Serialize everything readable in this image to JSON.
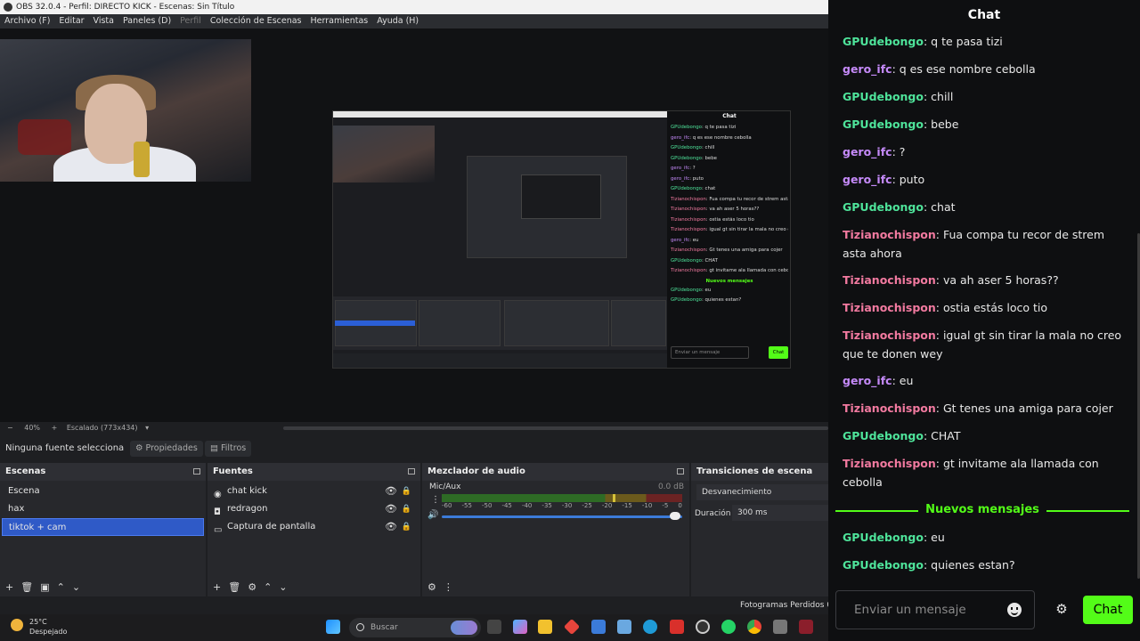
{
  "window": {
    "title": "OBS 32.0.4 - Perfil: DIRECTO KICK - Escenas: Sin Título",
    "menu": [
      "Archivo (F)",
      "Editar",
      "Vista",
      "Paneles (D)",
      "Perfil",
      "Colección de Escenas",
      "Herramientas",
      "Ayuda (H)"
    ]
  },
  "preview": {
    "zoom": "40%",
    "zoom_minus": "−",
    "zoom_plus": "+",
    "scale_label": "Escalado (773x434)"
  },
  "props_bar": {
    "no_source": "Ninguna fuente selecciona",
    "properties": "Propiedades",
    "filters": "Filtros"
  },
  "scenes": {
    "title": "Escenas",
    "items": [
      "Escena",
      "hax",
      "tiktok + cam"
    ],
    "selected": "tiktok + cam"
  },
  "sources": {
    "title": "Fuentes",
    "items": [
      {
        "label": "chat kick",
        "icon": "browser-icon"
      },
      {
        "label": "redragon",
        "icon": "camera-icon"
      },
      {
        "label": "Captura de pantalla",
        "icon": "monitor-icon"
      }
    ]
  },
  "mixer": {
    "title": "Mezclador de audio",
    "channel": "Mic/Aux",
    "db": "0.0 dB",
    "ticks": [
      "-60",
      "-55",
      "-50",
      "-45",
      "-40",
      "-35",
      "-30",
      "-25",
      "-20",
      "-15",
      "-10",
      "-5",
      "0"
    ],
    "peak_level": 0.71,
    "volume_level": 1.0
  },
  "transitions": {
    "title": "Transiciones de escena",
    "type": "Desvanecimiento",
    "duration_label": "Duración",
    "duration_value": "300 ms"
  },
  "status": {
    "frames_dropped": "Fotogramas Perdidos 0 ("
  },
  "chat": {
    "title": "Chat",
    "new_messages": "Nuevos mensajes",
    "input_placeholder": "Enviar un mensaje",
    "send_button": "Chat",
    "colors": {
      "green": "#53fc18",
      "teal": "#4ee39a",
      "purple": "#c58af9",
      "pink": "#f27aa0"
    },
    "messages": [
      {
        "user": "GPUdebongo",
        "text": "q te pasa tizi",
        "color": "#4ee39a"
      },
      {
        "user": "gero_ifc",
        "text": "q es ese nombre cebolla",
        "color": "#c58af9"
      },
      {
        "user": "GPUdebongo",
        "text": "chill",
        "color": "#4ee39a"
      },
      {
        "user": "GPUdebongo",
        "text": "bebe",
        "color": "#4ee39a"
      },
      {
        "user": "gero_ifc",
        "text": "?",
        "color": "#c58af9"
      },
      {
        "user": "gero_ifc",
        "text": "puto",
        "color": "#c58af9"
      },
      {
        "user": "GPUdebongo",
        "text": "chat",
        "color": "#4ee39a"
      },
      {
        "user": "Tizianochispon",
        "text": "Fua compa tu recor de strem asta ahora",
        "color": "#f27aa0"
      },
      {
        "user": "Tizianochispon",
        "text": "va ah aser 5 horas??",
        "color": "#f27aa0"
      },
      {
        "user": "Tizianochispon",
        "text": "ostia estás loco tio",
        "color": "#f27aa0"
      },
      {
        "user": "Tizianochispon",
        "text": "igual gt sin tirar la mala no creo que te donen wey",
        "color": "#f27aa0"
      },
      {
        "user": "gero_ifc",
        "text": "eu",
        "color": "#c58af9"
      },
      {
        "user": "Tizianochispon",
        "text": "Gt tenes una amiga para cojer",
        "color": "#f27aa0"
      },
      {
        "user": "GPUdebongo",
        "text": "CHAT",
        "color": "#4ee39a"
      },
      {
        "user": "Tizianochispon",
        "text": "gt invitame ala llamada con cebolla",
        "color": "#f27aa0"
      },
      {
        "user": "GPUdebongo",
        "text": "eu",
        "color": "#4ee39a"
      },
      {
        "user": "GPUdebongo",
        "text": "quienes estan?",
        "color": "#4ee39a"
      }
    ]
  },
  "taskbar": {
    "temp": "25°C",
    "condition": "Despejado",
    "search": "Buscar"
  }
}
